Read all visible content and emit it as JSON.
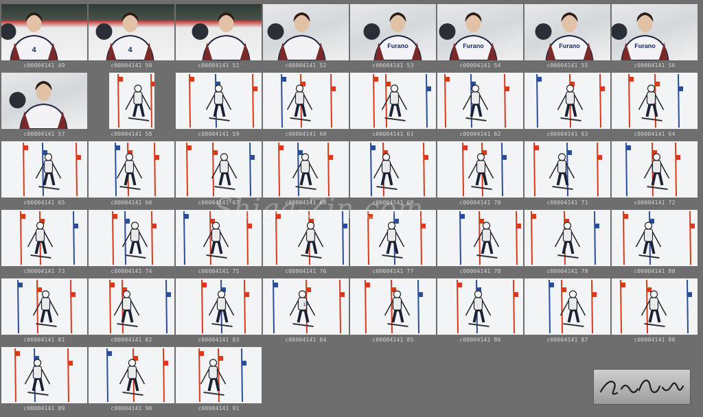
{
  "watermark": "Shiga-Zin.com",
  "signature": "Zin Shiga",
  "photos": [
    {
      "label": "c00004141 49",
      "kind": "crowd",
      "bib": "4"
    },
    {
      "label": "c00004141 50",
      "kind": "crowd",
      "bib": "4"
    },
    {
      "label": "c00004141 51",
      "kind": "crowd",
      "bib": ""
    },
    {
      "label": "c00004141 52",
      "kind": "close",
      "bib": ""
    },
    {
      "label": "c00004141 53",
      "kind": "close",
      "bib": "Furano"
    },
    {
      "label": "c00004141 54",
      "kind": "close",
      "bib": "Furano"
    },
    {
      "label": "c00004141 55",
      "kind": "close",
      "bib": "Furano"
    },
    {
      "label": "c00004141 56",
      "kind": "close",
      "bib": "Furano"
    },
    {
      "label": "c00004141 57",
      "kind": "close",
      "bib": ""
    },
    {
      "label": "c00004141 58",
      "kind": "narrow",
      "bib": ""
    },
    {
      "label": "c00004141 59",
      "kind": "ski",
      "bib": ""
    },
    {
      "label": "c00004141 60",
      "kind": "ski",
      "bib": ""
    },
    {
      "label": "c00004141 61",
      "kind": "ski",
      "bib": ""
    },
    {
      "label": "c00004141 62",
      "kind": "ski",
      "bib": ""
    },
    {
      "label": "c00004141 63",
      "kind": "ski",
      "bib": ""
    },
    {
      "label": "c00004141 64",
      "kind": "ski",
      "bib": ""
    },
    {
      "label": "c00004141 65",
      "kind": "ski",
      "bib": ""
    },
    {
      "label": "c00004141 66",
      "kind": "ski",
      "bib": ""
    },
    {
      "label": "c00004141 67",
      "kind": "ski",
      "bib": ""
    },
    {
      "label": "c00004141 68",
      "kind": "ski",
      "bib": ""
    },
    {
      "label": "c00004141 69",
      "kind": "ski",
      "bib": ""
    },
    {
      "label": "c00004141 70",
      "kind": "ski",
      "bib": ""
    },
    {
      "label": "c00004141 71",
      "kind": "ski",
      "bib": ""
    },
    {
      "label": "c00004141 72",
      "kind": "ski",
      "bib": ""
    },
    {
      "label": "c00004141 73",
      "kind": "ski",
      "bib": ""
    },
    {
      "label": "c00004141 74",
      "kind": "ski",
      "bib": ""
    },
    {
      "label": "c00004141 75",
      "kind": "ski",
      "bib": ""
    },
    {
      "label": "c00004141 76",
      "kind": "ski",
      "bib": ""
    },
    {
      "label": "c00004141 77",
      "kind": "ski",
      "bib": ""
    },
    {
      "label": "c00004141 78",
      "kind": "ski",
      "bib": ""
    },
    {
      "label": "c00004141 79",
      "kind": "ski",
      "bib": ""
    },
    {
      "label": "c00004141 80",
      "kind": "ski",
      "bib": ""
    },
    {
      "label": "c00004141 81",
      "kind": "ski",
      "bib": ""
    },
    {
      "label": "c00004141 82",
      "kind": "ski",
      "bib": ""
    },
    {
      "label": "c00004141 83",
      "kind": "ski",
      "bib": ""
    },
    {
      "label": "c00004141 84",
      "kind": "ski",
      "bib": "14"
    },
    {
      "label": "c00004141 85",
      "kind": "ski",
      "bib": ""
    },
    {
      "label": "c00004141 86",
      "kind": "ski",
      "bib": ""
    },
    {
      "label": "c00004141 87",
      "kind": "ski",
      "bib": ""
    },
    {
      "label": "c00004141 88",
      "kind": "ski",
      "bib": ""
    },
    {
      "label": "c00004141 89",
      "kind": "ski",
      "bib": ""
    },
    {
      "label": "c00004141 90",
      "kind": "ski",
      "bib": ""
    },
    {
      "label": "c00004141 91",
      "kind": "ski",
      "bib": ""
    }
  ]
}
